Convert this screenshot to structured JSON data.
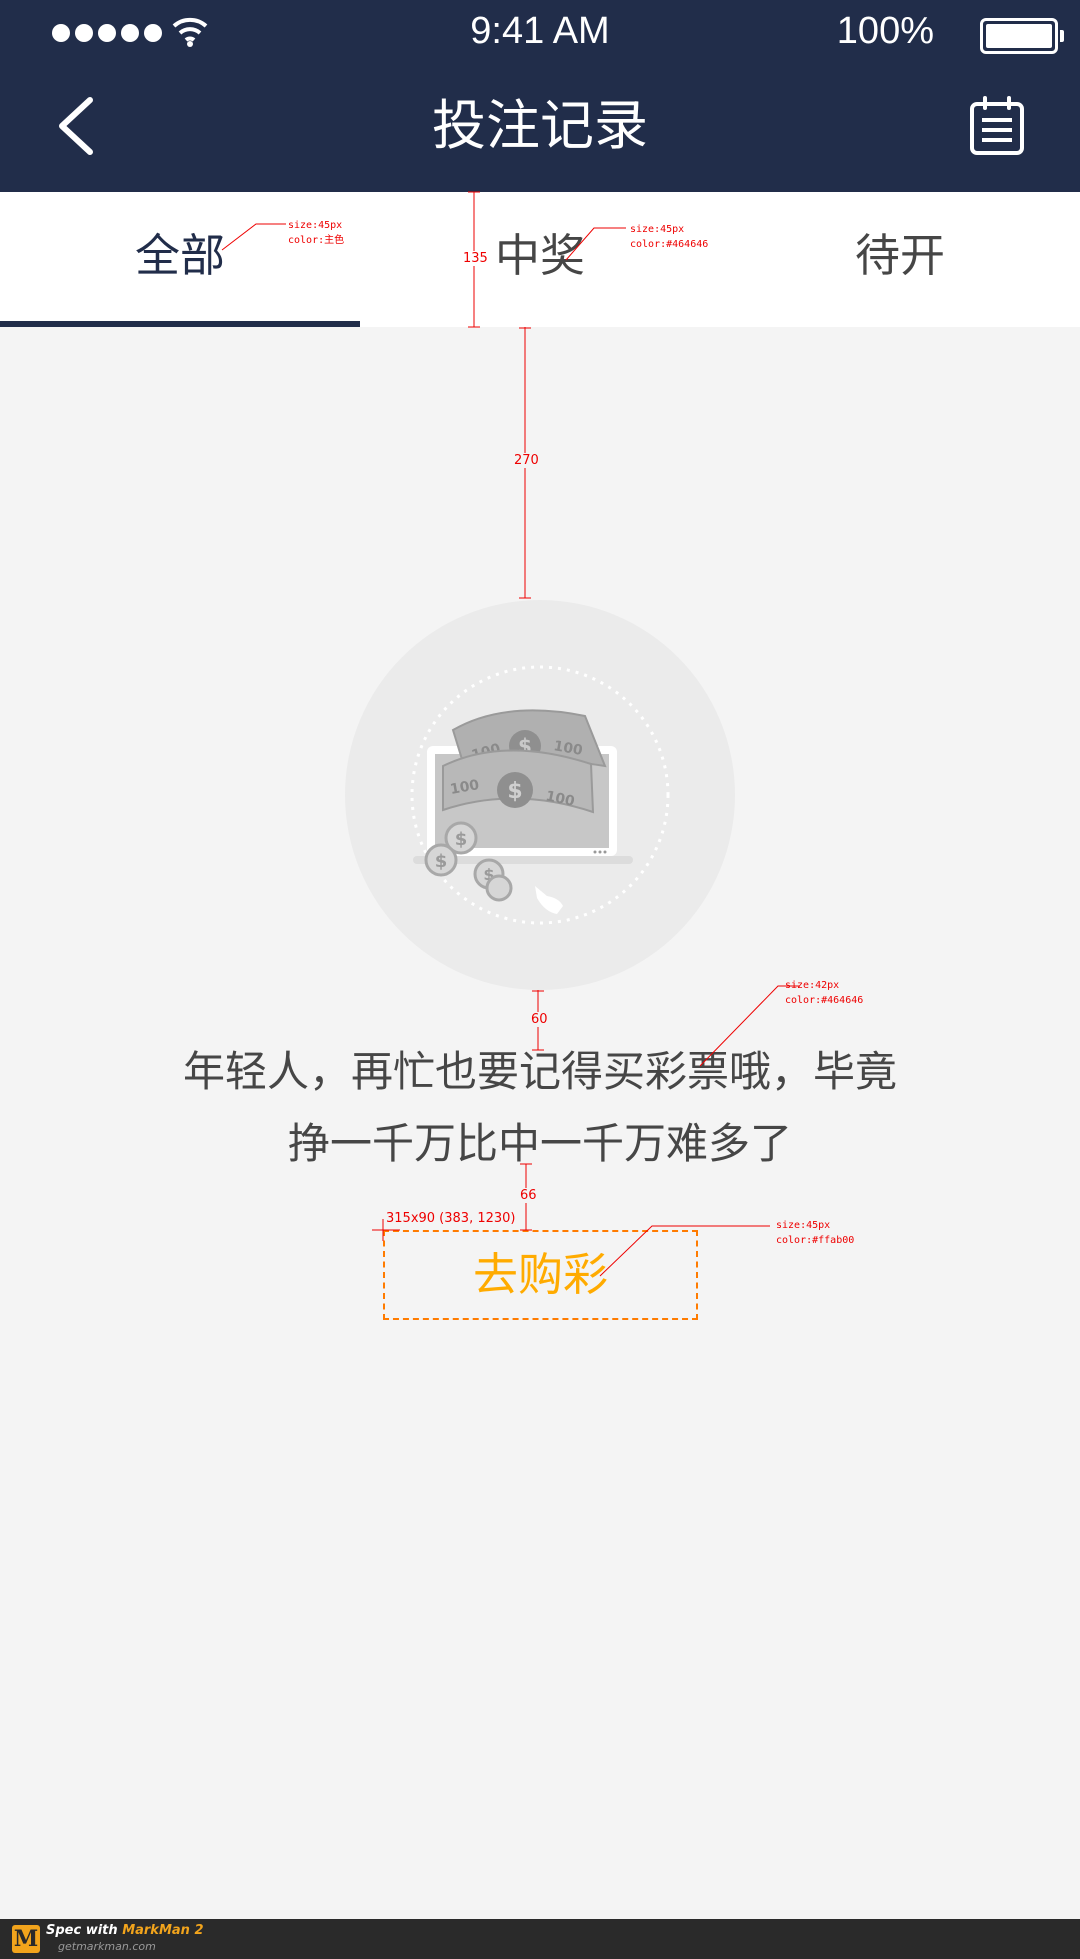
{
  "status_bar": {
    "time": "9:41 AM",
    "battery": "100%"
  },
  "nav": {
    "title": "投注记录",
    "back_icon": "chevron-left-icon",
    "right_icon": "calendar-list-icon"
  },
  "tabs": [
    {
      "label": "全部",
      "active": true
    },
    {
      "label": "中奖",
      "active": false
    },
    {
      "label": "待开",
      "active": false
    }
  ],
  "empty_state": {
    "illustration": "laptop-money-icon",
    "message_line1": "年轻人，再忙也要记得买彩票哦，毕竟",
    "message_line2": "挣一千万比中一千万难多了",
    "button_label": "去购彩"
  },
  "colors": {
    "primary": "#212d4a",
    "text": "#464646",
    "accent": "#ffab00",
    "background": "#f4f4f4"
  },
  "annotations": {
    "tab_all_spec_1": "size:45px",
    "tab_all_spec_2": "color:主色",
    "tab_win_spec_1": "size:45px",
    "tab_win_spec_2": "color:#464646",
    "tab_height": "135",
    "gap_top": "270",
    "gap_mid": "60",
    "text_spec_1": "size:42px",
    "text_spec_2": "color:#464646",
    "gap_btn": "66",
    "button_box": "315x90 (383, 1230)",
    "button_spec_1": "size:45px",
    "button_spec_2": "color:#ffab00"
  },
  "footer": {
    "spec_with": "Spec with ",
    "brand": "MarkMan 2",
    "site": "getmarkman.com"
  }
}
